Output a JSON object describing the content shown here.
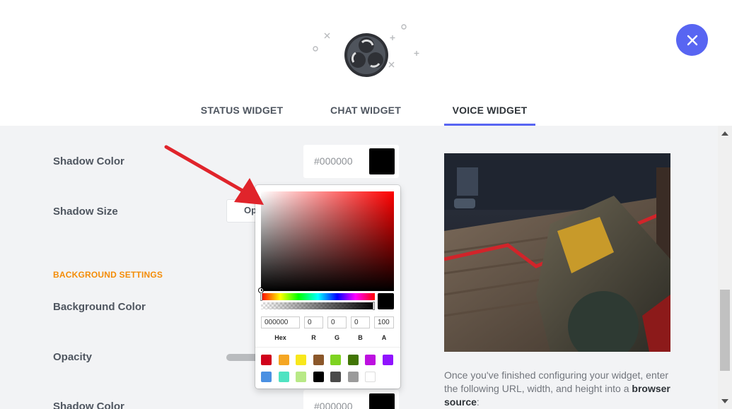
{
  "header": {
    "logo": "obs-logo-icon",
    "close_icon": "close-icon",
    "accent_color": "#5865f2"
  },
  "tabs": [
    {
      "label": "STATUS WIDGET",
      "active": false
    },
    {
      "label": "CHAT WIDGET",
      "active": false
    },
    {
      "label": "VOICE WIDGET",
      "active": true
    }
  ],
  "settings": {
    "shadow_color_label": "Shadow Color",
    "shadow_color_value": "#000000",
    "shadow_size_label": "Shadow Size",
    "shadow_size_value": "Op",
    "background_heading": "BACKGROUND SETTINGS",
    "background_color_label": "Background Color",
    "opacity_label": "Opacity",
    "shadow_color2_label": "Shadow Color",
    "shadow_color2_value": "#000000"
  },
  "color_picker": {
    "hex": "000000",
    "r": "0",
    "g": "0",
    "b": "0",
    "a": "100",
    "labels": {
      "hex": "Hex",
      "r": "R",
      "g": "G",
      "b": "B",
      "a": "A"
    },
    "presets": [
      "#d0021b",
      "#f5a623",
      "#f8e71c",
      "#8b572a",
      "#7ed321",
      "#417505",
      "#bd10e0",
      "#9013fe",
      "#4a90e2",
      "#50e3c2",
      "#b8e986",
      "#000000",
      "#4a4a4a",
      "#9b9b9b",
      "#ffffff"
    ]
  },
  "info": {
    "text": "Once you've finished configuring your widget, enter the following URL, width, and height into a",
    "bold": "browser source",
    "tail": ":"
  },
  "colors": {
    "heading_orange": "#f48c06",
    "annotation_red": "#e0242b"
  }
}
